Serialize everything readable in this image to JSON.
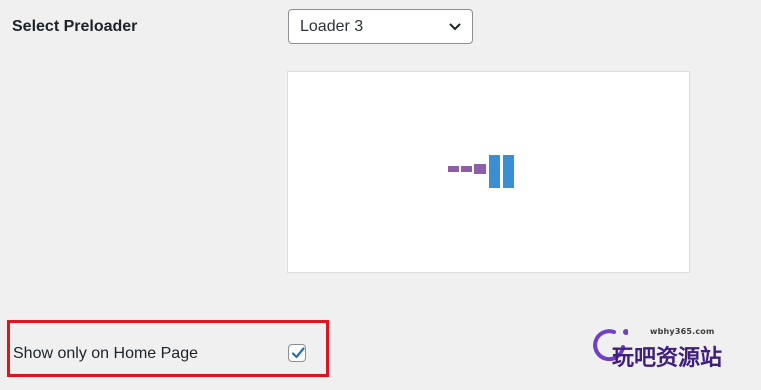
{
  "settings": {
    "preloader": {
      "label": "Select Preloader",
      "selected": "Loader 3"
    },
    "home_page": {
      "label": "Show only on Home Page",
      "checked": true
    }
  },
  "preview": {
    "loader_colors": [
      "#8e5ea8",
      "#3a8fd2"
    ]
  },
  "highlight": {
    "color": "#e0141e"
  },
  "watermark": {
    "url": "wbhy365.com",
    "text": "玩吧资源站"
  }
}
